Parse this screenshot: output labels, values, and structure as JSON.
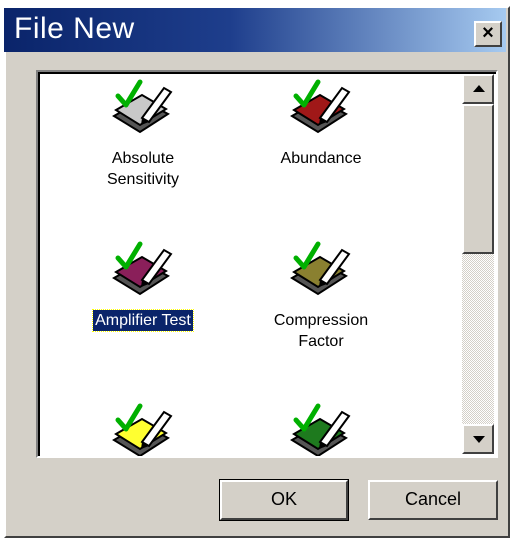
{
  "window": {
    "title": "File New",
    "close_label": "×"
  },
  "items": [
    {
      "label": "Absolute\nSensitivity",
      "icon": "absolute-sensitivity-icon",
      "color": "#c8c8c8",
      "selected": false
    },
    {
      "label": "Abundance",
      "icon": "abundance-icon",
      "color": "#a01818",
      "selected": false
    },
    {
      "label": "Amplifier Test",
      "icon": "amplifier-test-icon",
      "color": "#8a1f5a",
      "selected": true
    },
    {
      "label": "Compression\nFactor",
      "icon": "compression-factor-icon",
      "color": "#8a8030",
      "selected": false
    },
    {
      "label": "",
      "icon": "yellow-test-icon",
      "color": "#ffff30",
      "selected": false
    },
    {
      "label": "",
      "icon": "green-test-icon",
      "color": "#1e7a1e",
      "selected": false
    }
  ],
  "buttons": {
    "ok": "OK",
    "cancel": "Cancel"
  },
  "colors": {
    "title_bar": "#0a246a",
    "selection": "#0a246a",
    "checkmark": "#00b000"
  }
}
